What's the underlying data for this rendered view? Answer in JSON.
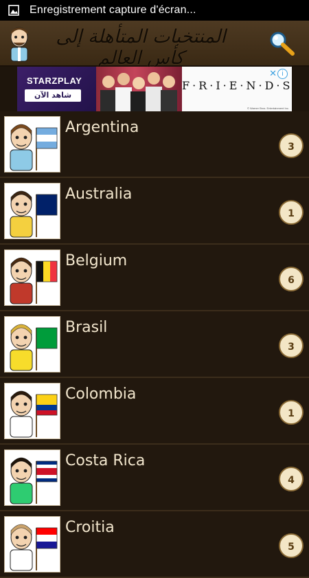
{
  "status_bar": {
    "notification_text": "Enregistrement capture d'écran..."
  },
  "app_bar": {
    "title": "المنتخبات المتأهلة إلى كأس العالم",
    "search_icon": "magnifier-icon",
    "avatar_icon": "player-cartoon-icon"
  },
  "ad": {
    "brand": "STARZPLAY",
    "cta": "شاهد الآن",
    "show_title": "F·R·I·E·N·D·S",
    "close": "✕",
    "info": "i",
    "copyright": "© Warner Bros. Entertainment Inc."
  },
  "teams": [
    {
      "name": "Argentina",
      "count": "3",
      "flag": [
        "#74acdf",
        "#ffffff",
        "#74acdf"
      ],
      "flag_dir": "h",
      "hair": "#7a4a1e",
      "shirt": "#8ecae6"
    },
    {
      "name": "Australia",
      "count": "1",
      "flag": [
        "#012169",
        "#012169",
        "#012169"
      ],
      "flag_dir": "h",
      "hair": "#3b2512",
      "shirt": "#f4d03f"
    },
    {
      "name": "Belgium",
      "count": "6",
      "flag": [
        "#111111",
        "#fdda24",
        "#ef3340"
      ],
      "flag_dir": "v",
      "hair": "#4a2a10",
      "shirt": "#c0392b"
    },
    {
      "name": "Brasil",
      "count": "3",
      "flag": [
        "#009c3b",
        "#009c3b",
        "#009c3b"
      ],
      "flag_dir": "h",
      "hair": "#d9b23a",
      "shirt": "#f7dc2b"
    },
    {
      "name": "Colombia",
      "count": "1",
      "flag": [
        "#fcd116",
        "#003893",
        "#ce1126"
      ],
      "flag_dir": "h3",
      "hair": "#2a1a0c",
      "shirt": "#ffffff"
    },
    {
      "name": "Costa Rica",
      "count": "4",
      "flag": [
        "#002b7f",
        "#ffffff",
        "#ce1126"
      ],
      "flag_dir": "h5",
      "hair": "#1f1409",
      "shirt": "#2ecc71"
    },
    {
      "name": "Croitia",
      "count": "5",
      "flag": [
        "#ff0000",
        "#ffffff",
        "#171796"
      ],
      "flag_dir": "h",
      "hair": "#c9a26b",
      "shirt": "#ffffff"
    }
  ],
  "colors": {
    "background": "#1e150c",
    "app_bar": "#4e3a22",
    "team_text": "#f2e6cd",
    "badge_bg": "#f3e6c6",
    "badge_text": "#5a3d12"
  }
}
